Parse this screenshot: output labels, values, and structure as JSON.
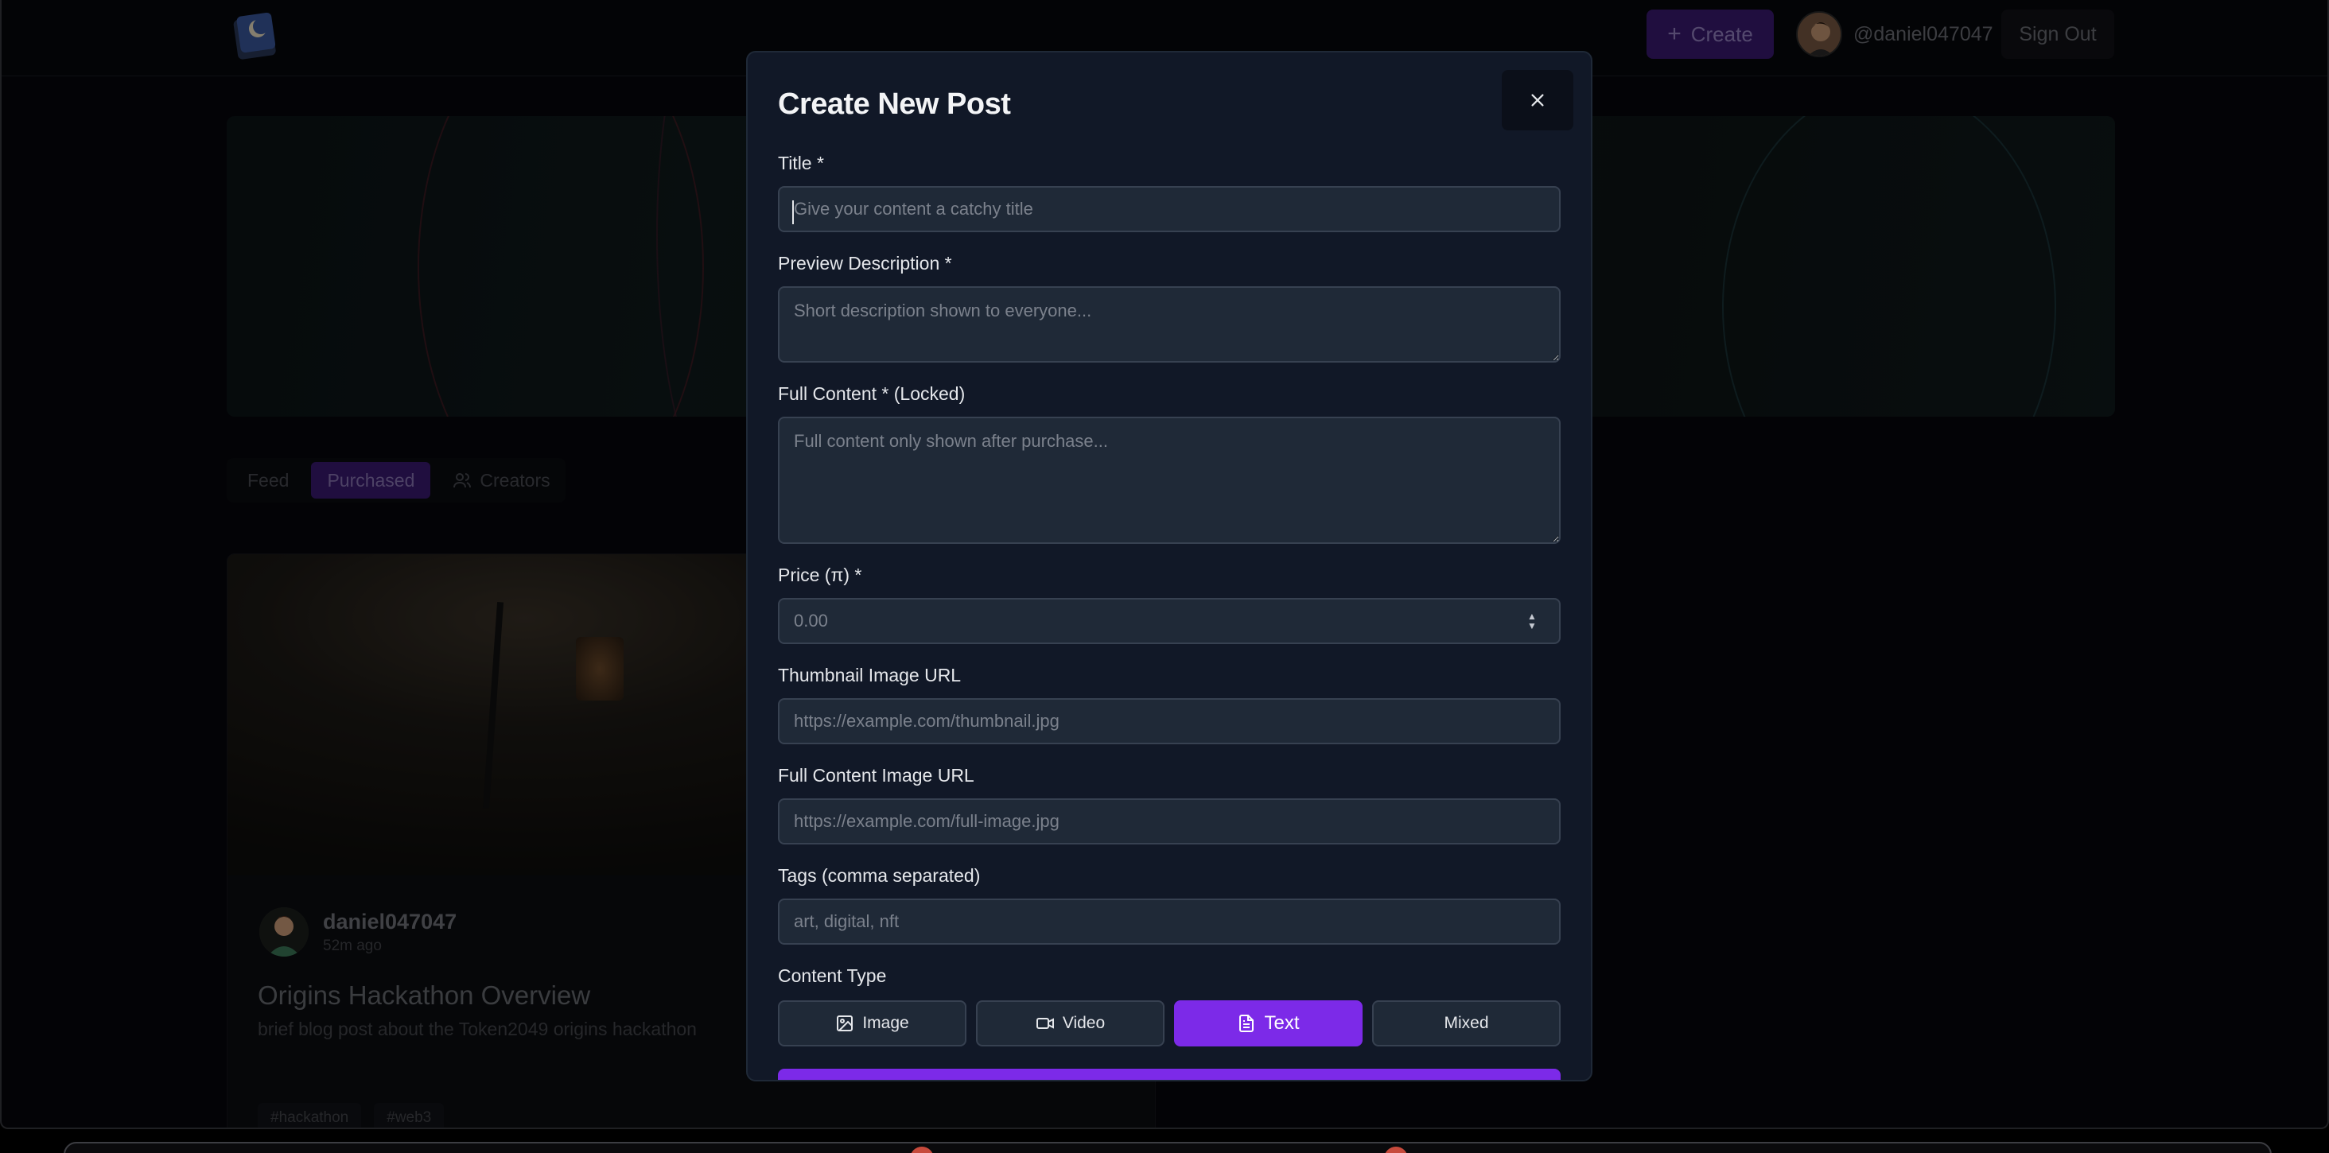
{
  "header": {
    "create_label": "Create",
    "username": "@daniel047047",
    "signout_label": "Sign Out"
  },
  "tabs": [
    {
      "label": "Feed"
    },
    {
      "label": "Purchased"
    },
    {
      "label": "Creators"
    }
  ],
  "card": {
    "author": "daniel047047",
    "time": "52m ago",
    "title": "Origins Hackathon Overview",
    "description": "brief blog post about the Token2049 origins hackathon",
    "tags": [
      "#hackathon",
      "#web3"
    ]
  },
  "modal": {
    "title": "Create New Post",
    "fields": {
      "title": {
        "label": "Title *",
        "placeholder": "Give your content a catchy title"
      },
      "preview": {
        "label": "Preview Description *",
        "placeholder": "Short description shown to everyone..."
      },
      "full": {
        "label": "Full Content * (Locked)",
        "placeholder": "Full content only shown after purchase..."
      },
      "price": {
        "label": "Price (π) *",
        "placeholder": "0.00"
      },
      "thumb": {
        "label": "Thumbnail Image URL",
        "placeholder": "https://example.com/thumbnail.jpg"
      },
      "fullimg": {
        "label": "Full Content Image URL",
        "placeholder": "https://example.com/full-image.jpg"
      },
      "tags": {
        "label": "Tags (comma separated)",
        "placeholder": "art, digital, nft"
      }
    },
    "content_type": {
      "label": "Content Type",
      "options": [
        {
          "label": "Image",
          "icon": "image-icon"
        },
        {
          "label": "Video",
          "icon": "video-icon"
        },
        {
          "label": "Text",
          "icon": "document-icon",
          "selected": true
        },
        {
          "label": "Mixed"
        }
      ]
    }
  },
  "colors": {
    "accent": "#7c2ae8",
    "modal_bg": "#111827",
    "field_bg": "#1f2937"
  }
}
